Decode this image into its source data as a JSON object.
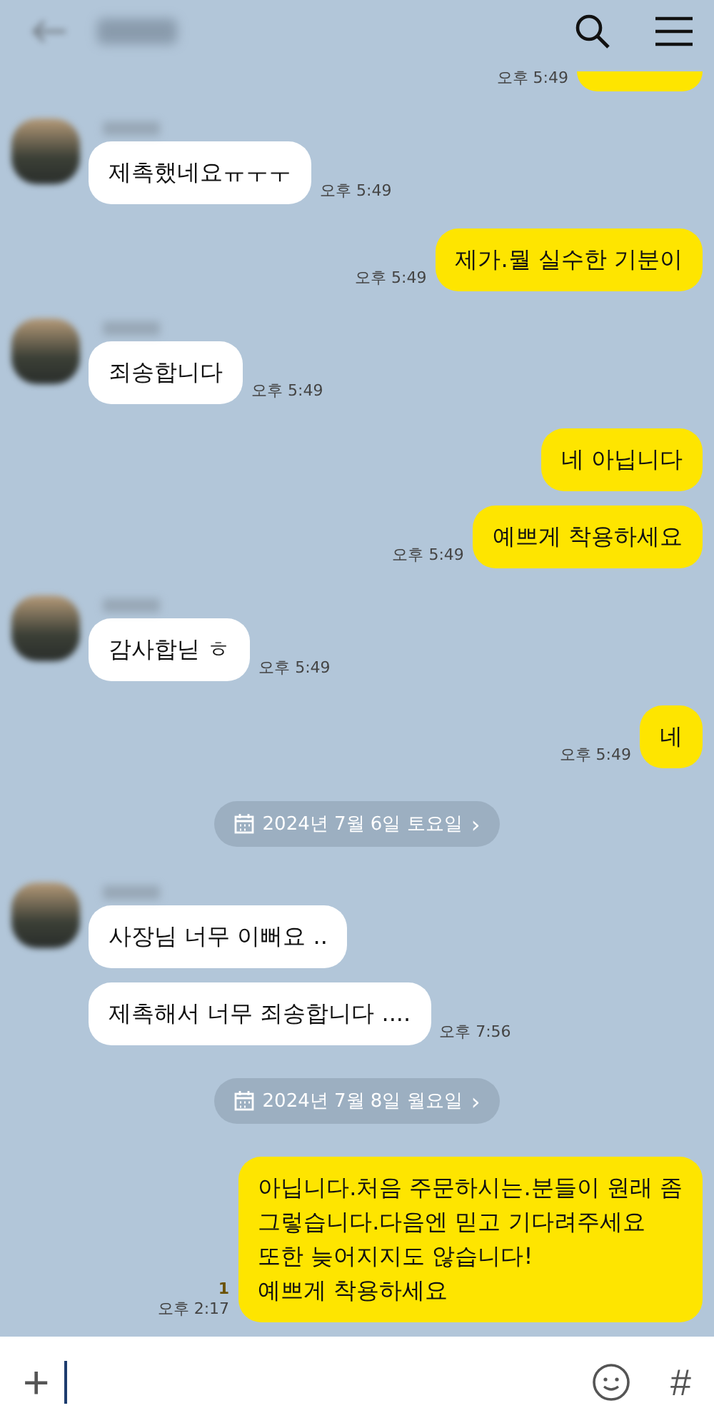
{
  "chat": {
    "items": [
      {
        "kind": "out_cut",
        "messages": [
          {
            "time": "오후 5:49"
          }
        ]
      },
      {
        "kind": "in",
        "messages": [
          {
            "text": "제촉했네요ㅠㅜㅜ",
            "time": "오후 5:49"
          }
        ]
      },
      {
        "kind": "out",
        "messages": [
          {
            "text": "제가.뭘 실수한 기분이",
            "time": "오후 5:49"
          }
        ]
      },
      {
        "kind": "in",
        "messages": [
          {
            "text": "죄송합니다",
            "time": "오후 5:49"
          }
        ]
      },
      {
        "kind": "out",
        "messages": [
          {
            "text": "네 아닙니다"
          },
          {
            "text": "예쁘게 착용하세요",
            "time": "오후 5:49"
          }
        ]
      },
      {
        "kind": "in",
        "messages": [
          {
            "text": "감사합닏 ㅎ",
            "time": "오후 5:49"
          }
        ]
      },
      {
        "kind": "out",
        "messages": [
          {
            "text": "네",
            "time": "오후 5:49"
          }
        ]
      },
      {
        "kind": "date",
        "label": "2024년 7월 6일 토요일",
        "arrow": "›"
      },
      {
        "kind": "in",
        "messages": [
          {
            "text": "사장님 너무 이뻐요 .."
          },
          {
            "text": "제촉해서 너무 죄송합니다 ....",
            "time": "오후 7:56"
          }
        ]
      },
      {
        "kind": "date",
        "label": "2024년 7월 8일 월요일",
        "arrow": "›"
      },
      {
        "kind": "out",
        "messages": [
          {
            "text": "아닙니다.처음 주문하시는.분들이 원래 좀\n그렇습니다.다음엔 믿고 기다려주세요\n또한 늦어지지도 않습니다!\n예쁘게 착용하세요",
            "time": "오후 2:17",
            "unread": "1"
          }
        ]
      }
    ]
  },
  "composer": {
    "plus": "+",
    "hash": "#"
  }
}
